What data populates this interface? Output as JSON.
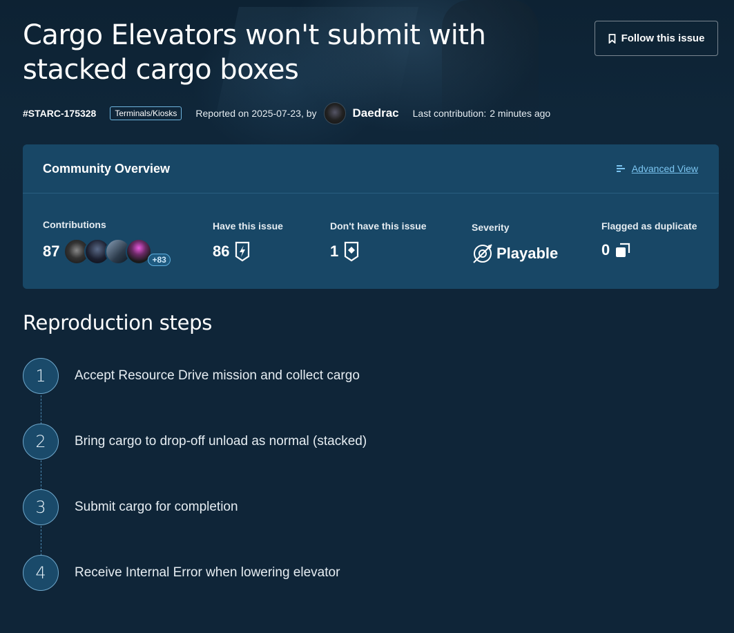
{
  "issue": {
    "title": "Cargo Elevators won't submit with stacked cargo boxes",
    "follow_label": "Follow this issue",
    "id": "#STARC-175328",
    "tag": "Terminals/Kiosks",
    "reported_text": "Reported on 2025-07-23, by",
    "author": "Daedrac",
    "last_contribution_label": "Last contribution:",
    "last_contribution_value": "2 minutes ago"
  },
  "overview": {
    "title": "Community Overview",
    "advanced_view_label": "Advanced View",
    "contributions": {
      "label": "Contributions",
      "value": "87",
      "more": "+83"
    },
    "have_issue": {
      "label": "Have this issue",
      "value": "86"
    },
    "dont_have_issue": {
      "label": "Don't have this issue",
      "value": "1"
    },
    "severity": {
      "label": "Severity",
      "value": "Playable"
    },
    "duplicate": {
      "label": "Flagged as duplicate",
      "value": "0"
    }
  },
  "repro": {
    "title": "Reproduction steps",
    "steps": [
      {
        "num": "1",
        "text": "Accept Resource Drive mission and collect cargo"
      },
      {
        "num": "2",
        "text": "Bring cargo to drop-off unload as normal (stacked)"
      },
      {
        "num": "3",
        "text": "Submit cargo for completion"
      },
      {
        "num": "4",
        "text": "Receive Internal Error when lowering elevator"
      }
    ]
  },
  "icons": {
    "follow": "bookmark-icon",
    "advanced_view": "list-icon",
    "have_issue": "lightning-shield-icon",
    "dont_have_issue": "plus-shield-icon",
    "severity": "playable-icon",
    "duplicate": "duplicate-icon"
  },
  "colors": {
    "background": "#0f2538",
    "panel": "#184766",
    "accent_link": "#7cc6f2"
  }
}
